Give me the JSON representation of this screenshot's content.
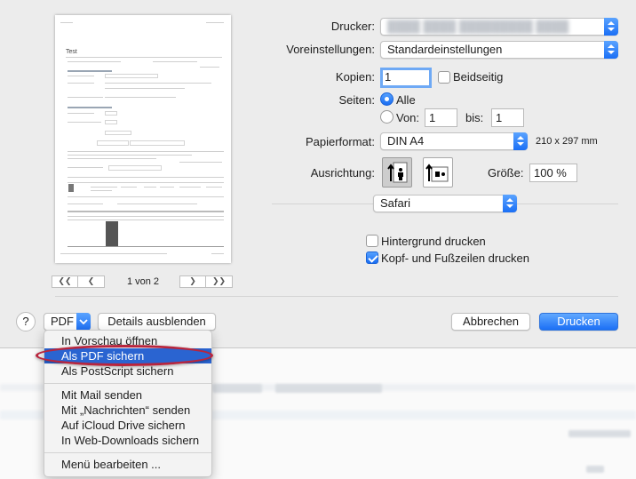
{
  "printer": {
    "label": "Drucker:",
    "value": "████ ████ █████████ ████"
  },
  "presets": {
    "label": "Voreinstellungen:",
    "value": "Standardeinstellungen"
  },
  "copies": {
    "label": "Kopien:",
    "value": "1",
    "duplex_label": "Beidseitig"
  },
  "pages": {
    "label": "Seiten:",
    "all_label": "Alle",
    "from_label": "Von:",
    "from_value": "1",
    "to_label": "bis:",
    "to_value": "1"
  },
  "paper": {
    "label": "Papierformat:",
    "value": "DIN A4",
    "dimensions": "210 x 297 mm"
  },
  "orientation": {
    "label": "Ausrichtung:",
    "scale_label": "Größe:",
    "scale_value": "100 %"
  },
  "app_section": {
    "value": "Safari"
  },
  "options": {
    "background_label": "Hintergrund drucken",
    "header_footer_label": "Kopf- und Fußzeilen drucken"
  },
  "preview": {
    "page_indicator": "1 von 2"
  },
  "footer": {
    "help": "?",
    "pdf_label": "PDF",
    "details_label": "Details ausblenden",
    "cancel_label": "Abbrechen",
    "print_label": "Drucken"
  },
  "pdf_menu": {
    "items": [
      "In Vorschau öffnen",
      "Als PDF sichern",
      "Als PostScript sichern",
      "Mit Mail senden",
      "Mit „Nachrichten“ senden",
      "Auf iCloud Drive sichern",
      "In Web-Downloads sichern",
      "Menü bearbeiten ..."
    ],
    "highlighted": "Als PDF sichern"
  },
  "colors": {
    "accent": "#1b6ff5",
    "highlight": "#2a64d1",
    "annotation": "#b8253d"
  }
}
